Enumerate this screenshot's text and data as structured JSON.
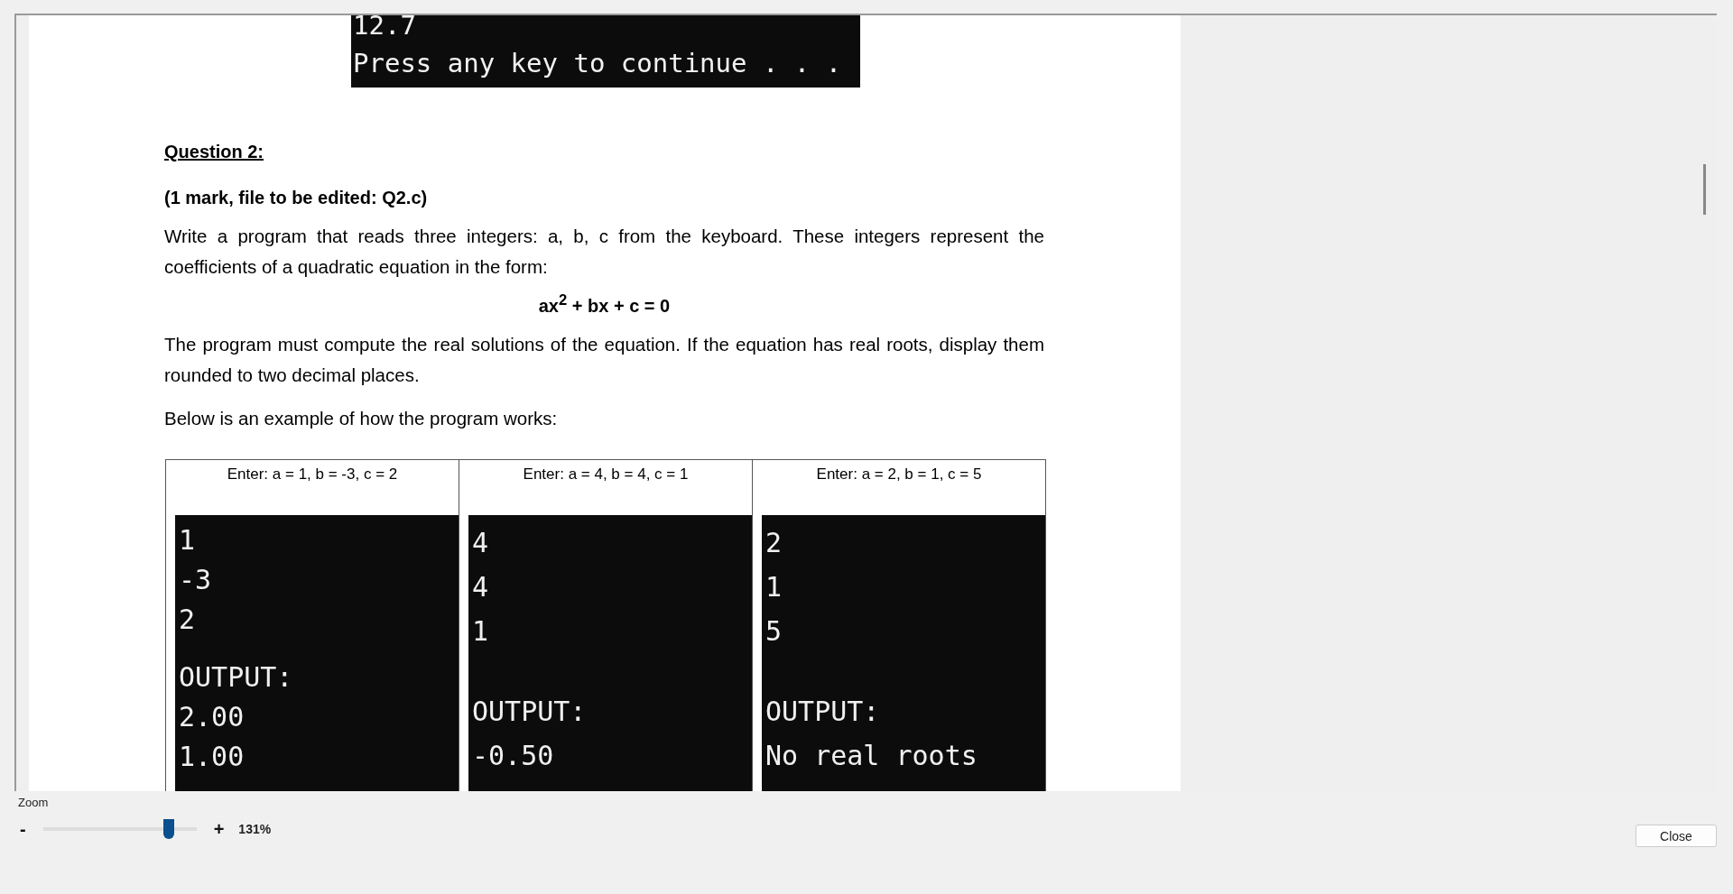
{
  "document": {
    "top_console": {
      "lines": [
        "12.7",
        "Press any key to continue . . ."
      ]
    },
    "heading": "Question 2:",
    "subheading": "(1 mark, file to be edited: Q2.c)",
    "paragraphs_before": [
      "Write a program that reads three integers: a, b, c from the keyboard. These integers represent the coefficients of a quadratic equation in the form:"
    ],
    "equation": "ax$^{2}$ + bx + c = 0",
    "paragraphs_after": [
      "The program must compute the real solutions of the equation. If the equation has real roots, display them rounded to two decimal places.",
      "Below is an example of how the program works:"
    ],
    "examples": [
      {
        "header": "Enter: a = 1, b = -3, c = 2",
        "input_lines": [
          "1",
          "-3",
          "2"
        ],
        "output_lines": [
          "OUTPUT:",
          "2.00",
          "1.00"
        ]
      },
      {
        "header": "Enter: a = 4, b = 4, c = 1",
        "input_lines": [
          "4",
          "4",
          "1"
        ],
        "output_lines": [
          "OUTPUT:",
          "-0.50"
        ]
      },
      {
        "header": "Enter: a = 2, b = 1, c = 5",
        "input_lines": [
          "2",
          "1",
          "5"
        ],
        "output_lines": [
          "OUTPUT:",
          "No real roots"
        ]
      }
    ]
  },
  "zoom_panel": {
    "label": "Zoom",
    "minus": "-",
    "plus": "+",
    "slider": {
      "level": 0.79
    },
    "reading": "131%"
  },
  "buttons": [
    "Close"
  ]
}
